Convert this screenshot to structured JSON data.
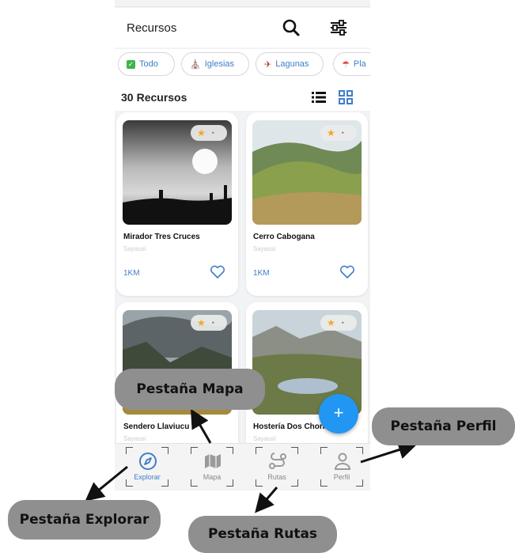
{
  "header": {
    "title": "Recursos",
    "search_icon": "search-icon",
    "filter_icon": "sliders-icon"
  },
  "filters": [
    {
      "label": "Todo",
      "icon": "checkbox-icon"
    },
    {
      "label": "Iglesias",
      "icon": "church-icon"
    },
    {
      "label": "Lagunas",
      "icon": "canoe-icon"
    },
    {
      "label": "Pla",
      "icon": "beach-icon"
    }
  ],
  "results": {
    "count": "30",
    "label": "Recursos"
  },
  "cards": [
    {
      "name": "Mirador Tres Cruces",
      "subtitle": "Sayausí",
      "distance": "1KM",
      "badge": "★"
    },
    {
      "name": "Cerro Cabogana",
      "subtitle": "Sayausí",
      "distance": "1KM",
      "badge": "★"
    },
    {
      "name": "Sendero Llaviucu",
      "subtitle": "Sayausí",
      "badge": "★"
    },
    {
      "name": "Hostería Dos Chorr",
      "subtitle": "Sayausí",
      "badge": "★"
    }
  ],
  "fab": {
    "label": "+"
  },
  "nav": [
    {
      "label": "Explorar",
      "icon": "compass-icon"
    },
    {
      "label": "Mapa",
      "icon": "map-icon"
    },
    {
      "label": "Rutas",
      "icon": "route-icon"
    },
    {
      "label": "Perfil",
      "icon": "person-icon"
    }
  ],
  "callouts": {
    "mapa": "Pestaña Mapa",
    "perfil": "Pestaña Perfil",
    "explorar": "Pestaña Explorar",
    "rutas": "Pestaña Rutas"
  },
  "colors": {
    "accent": "#3f7ec8",
    "fab": "#2196f3",
    "star": "#f5a623",
    "callout": "#8f8f8f"
  }
}
